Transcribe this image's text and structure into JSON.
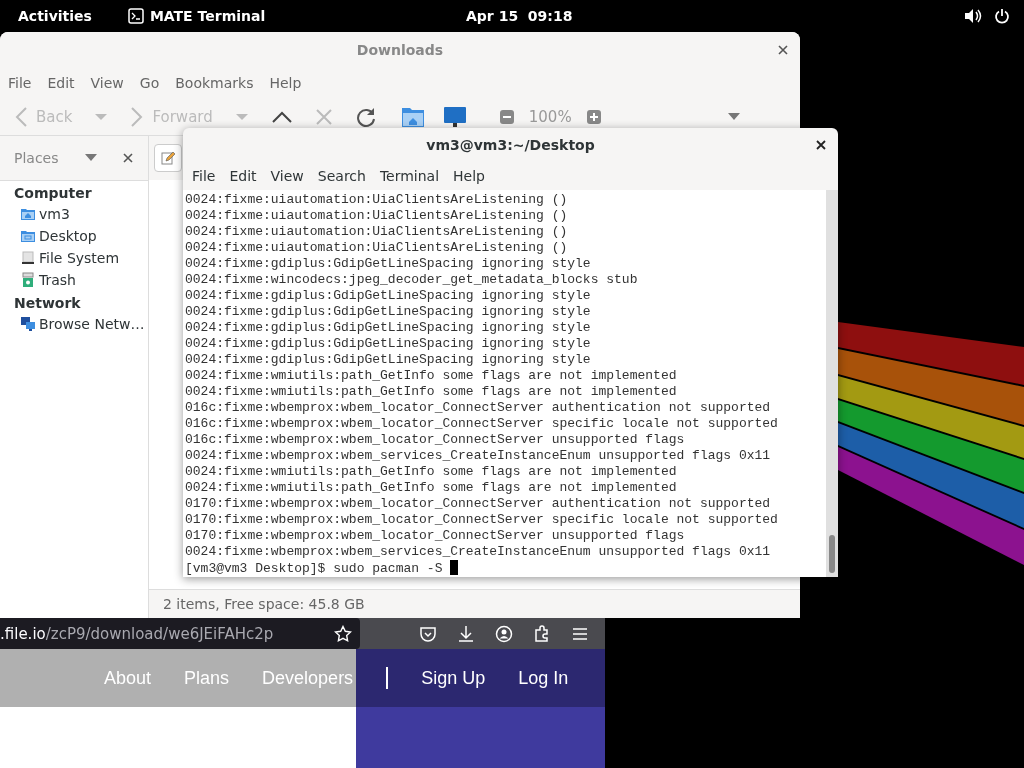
{
  "top_bar": {
    "activities": "Activities",
    "app": "MATE Terminal",
    "clock": "Apr 15  09:18"
  },
  "browser": {
    "url_host": ".file.io",
    "url_path": "/zcP9/download/we6JEiFAHc2p",
    "nav_links": [
      "About",
      "Plans",
      "Developers"
    ],
    "account_links": [
      "Sign Up",
      "Log In"
    ]
  },
  "files": {
    "title": "Downloads",
    "menu": [
      "File",
      "Edit",
      "View",
      "Go",
      "Bookmarks",
      "Help"
    ],
    "nav_buttons": [
      {
        "label": "Back",
        "disabled": true
      },
      {
        "label": "Forward",
        "disabled": true
      }
    ],
    "zoom": "100%",
    "places_label": "Places",
    "sections": [
      {
        "heading": "Computer",
        "items": [
          {
            "label": "vm3",
            "kind": "home"
          },
          {
            "label": "Desktop",
            "kind": "desktop"
          },
          {
            "label": "File System",
            "kind": "drive"
          },
          {
            "label": "Trash",
            "kind": "trash"
          }
        ]
      },
      {
        "heading": "Network",
        "items": [
          {
            "label": "Browse Netw…",
            "kind": "network"
          }
        ]
      }
    ],
    "status": "2 items, Free space: 45.8 GB"
  },
  "terminal": {
    "title": "vm3@vm3:~/Desktop",
    "menu": [
      "File",
      "Edit",
      "View",
      "Search",
      "Terminal",
      "Help"
    ],
    "lines": [
      "0024:fixme:uiautomation:UiaClientsAreListening ()",
      "0024:fixme:uiautomation:UiaClientsAreListening ()",
      "0024:fixme:uiautomation:UiaClientsAreListening ()",
      "0024:fixme:uiautomation:UiaClientsAreListening ()",
      "0024:fixme:gdiplus:GdipGetLineSpacing ignoring style",
      "0024:fixme:wincodecs:jpeg_decoder_get_metadata_blocks stub",
      "0024:fixme:gdiplus:GdipGetLineSpacing ignoring style",
      "0024:fixme:gdiplus:GdipGetLineSpacing ignoring style",
      "0024:fixme:gdiplus:GdipGetLineSpacing ignoring style",
      "0024:fixme:gdiplus:GdipGetLineSpacing ignoring style",
      "0024:fixme:gdiplus:GdipGetLineSpacing ignoring style",
      "0024:fixme:wmiutils:path_GetInfo some flags are not implemented",
      "0024:fixme:wmiutils:path_GetInfo some flags are not implemented",
      "016c:fixme:wbemprox:wbem_locator_ConnectServer authentication not supported",
      "016c:fixme:wbemprox:wbem_locator_ConnectServer specific locale not supported",
      "016c:fixme:wbemprox:wbem_locator_ConnectServer unsupported flags",
      "0024:fixme:wbemprox:wbem_services_CreateInstanceEnum unsupported flags 0x11",
      "0024:fixme:wmiutils:path_GetInfo some flags are not implemented",
      "0024:fixme:wmiutils:path_GetInfo some flags are not implemented",
      "0170:fixme:wbemprox:wbem_locator_ConnectServer authentication not supported",
      "0170:fixme:wbemprox:wbem_locator_ConnectServer specific locale not supported",
      "0170:fixme:wbemprox:wbem_locator_ConnectServer unsupported flags",
      "0024:fixme:wbemprox:wbem_services_CreateInstanceEnum unsupported flags 0x11"
    ],
    "prompt": "[vm3@vm3 Desktop]$ sudo pacman -S"
  }
}
